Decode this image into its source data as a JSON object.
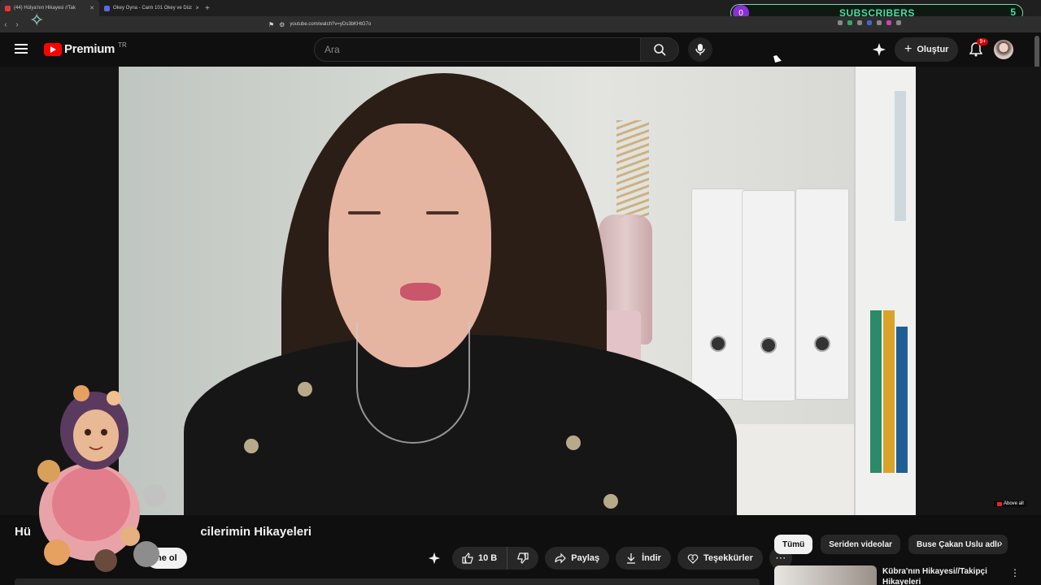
{
  "browser": {
    "tabs": [
      {
        "label": "(44) Hülya'nın Hikayesi //Tak",
        "active": true
      },
      {
        "label": "Okey Oyna - Canlı 101 Okey ve Düz",
        "active": false
      }
    ],
    "url": "youtube.com/watch?v=yDs3bKHtG7o"
  },
  "overlay_widget": {
    "label": "SUBSCRIBERS",
    "current": "0",
    "goal": "5",
    "color": "#3fe0a3"
  },
  "youtube_header": {
    "logo_text": "Premium",
    "country_code": "TR",
    "search_placeholder": "Ara",
    "create_label": "Oluştur",
    "notification_badge": "9+"
  },
  "video": {
    "title_start": "Hü",
    "title_end": "cilerimin Hikayeleri",
    "subscribe_partial": "ne ol",
    "watermark": "Above all"
  },
  "actions": {
    "like_count": "10 B",
    "share_label": "Paylaş",
    "download_label": "İndir",
    "thanks_label": "Teşekkürler",
    "more": "⋯"
  },
  "sidebar": {
    "chips": [
      {
        "label": "Tümü",
        "selected": true
      },
      {
        "label": "Seriden videolar",
        "selected": false
      },
      {
        "label": "Buse Çakan Uslu adlı",
        "selected": false
      }
    ],
    "next_arrow": "›",
    "recommendation": {
      "title": "Kübra'nın Hikayesi//Takipçi Hikayeleri"
    }
  },
  "colors": {
    "background": "#0f0f0f",
    "brand_red": "#ff0000",
    "chip_selected": "#f1f1f1"
  }
}
